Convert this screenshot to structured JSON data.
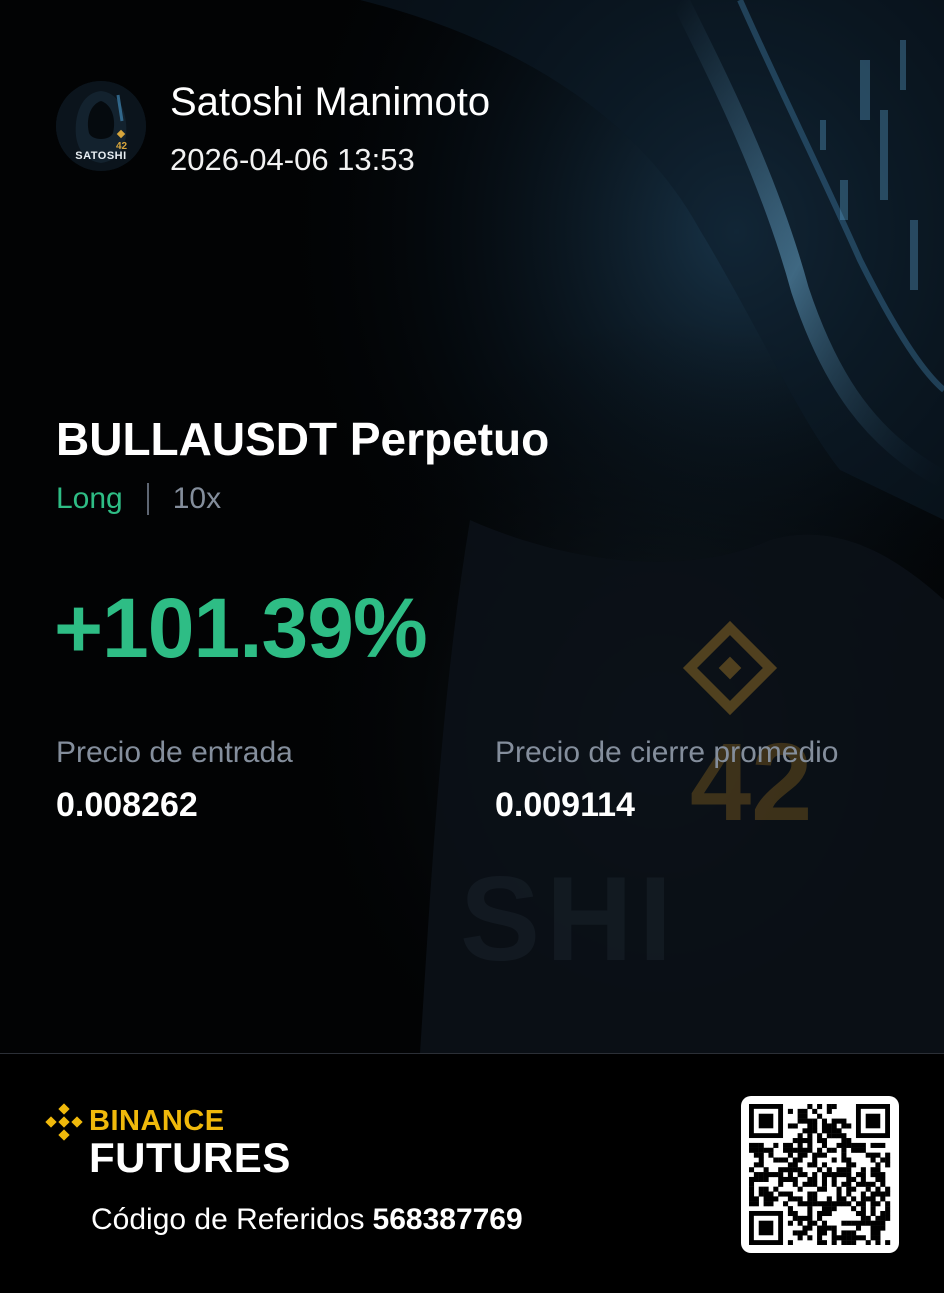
{
  "user": {
    "name": "Satoshi Manimoto",
    "datetime": "2026-04-06 13:53",
    "avatar_text": "SATOSHI",
    "avatar_badge": "42"
  },
  "position": {
    "contract": "BULLAUSDT Perpetuo",
    "side": "Long",
    "leverage": "10x",
    "pnl_percent": "+101.39%"
  },
  "prices": {
    "entry_label": "Precio de entrada",
    "entry_value": "0.008262",
    "close_label": "Precio de cierre promedio",
    "close_value": "0.009114"
  },
  "footer": {
    "brand": "BINANCE",
    "product": "FUTURES",
    "referral_label": "Código de Referidos",
    "referral_code": "568387769"
  },
  "colors": {
    "profit": "#2ebd85",
    "brand": "#f0b90b",
    "muted": "#848e9c",
    "background": "#020304"
  },
  "icons": {
    "avatar": "hooded-figure-avatar",
    "logo": "binance-logo-icon",
    "qr": "qr-code"
  }
}
